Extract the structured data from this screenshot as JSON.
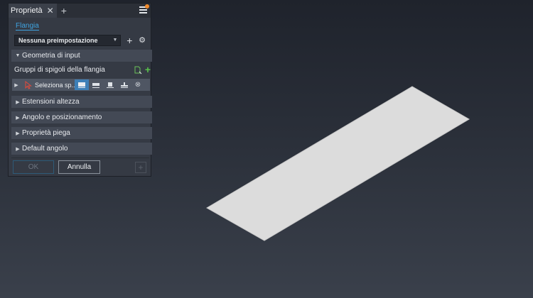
{
  "panel": {
    "tab_title": "Proprietà",
    "tab_close": "✕",
    "tab_add": "+",
    "feature_link": "Flangia",
    "preset": {
      "value": "Nessuna preimpostazione",
      "add": "+",
      "settings": "⚙"
    }
  },
  "sections": {
    "input_geometry": "Geometria di input",
    "height_extents": "Estensioni altezza",
    "angle_position": "Angolo e posizionamento",
    "bend_properties": "Proprietà piega",
    "default_angle": "Default angolo"
  },
  "edge_groups": {
    "label": "Gruppi di spigoli della flangia",
    "add": "+"
  },
  "edge_selection": {
    "label": "Seleziona sp...",
    "clear": "⊗"
  },
  "buttons": {
    "ok": "OK",
    "cancel": "Annulla",
    "apply_plus": "+"
  },
  "colors": {
    "accent": "#3fa4e0",
    "active_option": "#3d7fb7",
    "add_green": "#59c14a",
    "notification": "#f08a2b",
    "plate": "#dcdcdc"
  },
  "icons": [
    "menu-icon",
    "document-select-icon",
    "cursor-pointer-icon",
    "flange-option-icons",
    "clear-icon",
    "gear-icon"
  ]
}
